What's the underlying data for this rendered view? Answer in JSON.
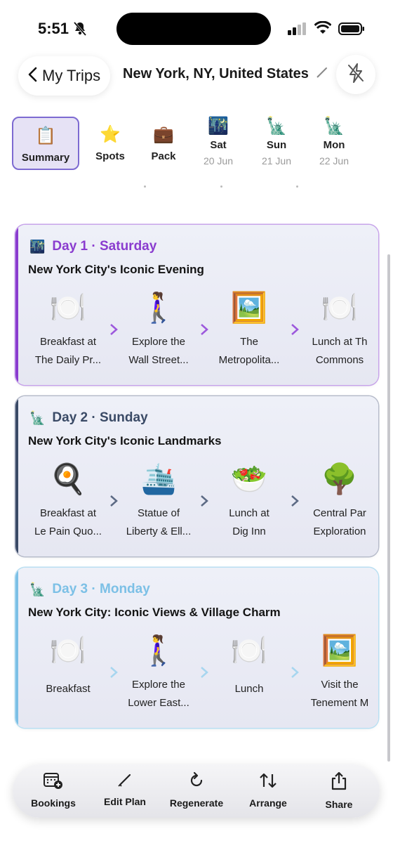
{
  "status": {
    "time": "5:51"
  },
  "header": {
    "back_label": "My Trips",
    "trip_title": "New York, NY, United States"
  },
  "tabs": [
    {
      "label": "Summary",
      "icon": "📋",
      "active": true
    },
    {
      "label": "Spots",
      "icon": "⭐"
    },
    {
      "label": "Pack",
      "icon": "💼"
    },
    {
      "label": "Sat",
      "date": "20 Jun",
      "icon": "🌃"
    },
    {
      "label": "Sun",
      "date": "21 Jun",
      "icon": "🗽"
    },
    {
      "label": "Mon",
      "date": "22 Jun",
      "icon": "🗽"
    }
  ],
  "days": [
    {
      "icon": "🌃",
      "title": "Day 1 · Saturday",
      "subtitle": "New York City's Iconic Evening",
      "color": "#8a3ccf",
      "activities": [
        {
          "emoji": "🍽️",
          "line1": "Breakfast at",
          "line2": "The Daily Pr..."
        },
        {
          "emoji": "🚶‍♀️",
          "line1": "Explore the",
          "line2": "Wall Street..."
        },
        {
          "emoji": "🖼️",
          "line1": "The",
          "line2": "Metropolita..."
        },
        {
          "emoji": "🍽️",
          "line1": "Lunch at Th",
          "line2": "Commons"
        }
      ]
    },
    {
      "icon": "🗽",
      "title": "Day 2 · Sunday",
      "subtitle": "New York City's Iconic Landmarks",
      "color": "#3a4a66",
      "activities": [
        {
          "emoji": "🍳",
          "line1": "Breakfast at",
          "line2": "Le Pain Quo..."
        },
        {
          "emoji": "🛳️",
          "line1": "Statue of",
          "line2": "Liberty & Ell..."
        },
        {
          "emoji": "🥗",
          "line1": "Lunch at",
          "line2": "Dig Inn"
        },
        {
          "emoji": "🌳",
          "line1": "Central Par",
          "line2": "Exploration"
        }
      ]
    },
    {
      "icon": "🗽",
      "title": "Day 3 · Monday",
      "subtitle": "New York City: Iconic Views & Village Charm",
      "color": "#7cc0e6",
      "activities": [
        {
          "emoji": "🍽️",
          "line1": "Breakfast",
          "line2": ""
        },
        {
          "emoji": "🚶‍♀️",
          "line1": "Explore the",
          "line2": "Lower East..."
        },
        {
          "emoji": "🍽️",
          "line1": "Lunch",
          "line2": ""
        },
        {
          "emoji": "🖼️",
          "line1": "Visit the",
          "line2": "Tenement M"
        }
      ]
    }
  ],
  "toolbar": {
    "bookings": "Bookings",
    "edit_plan": "Edit Plan",
    "regenerate": "Regenerate",
    "arrange": "Arrange",
    "share": "Share"
  }
}
